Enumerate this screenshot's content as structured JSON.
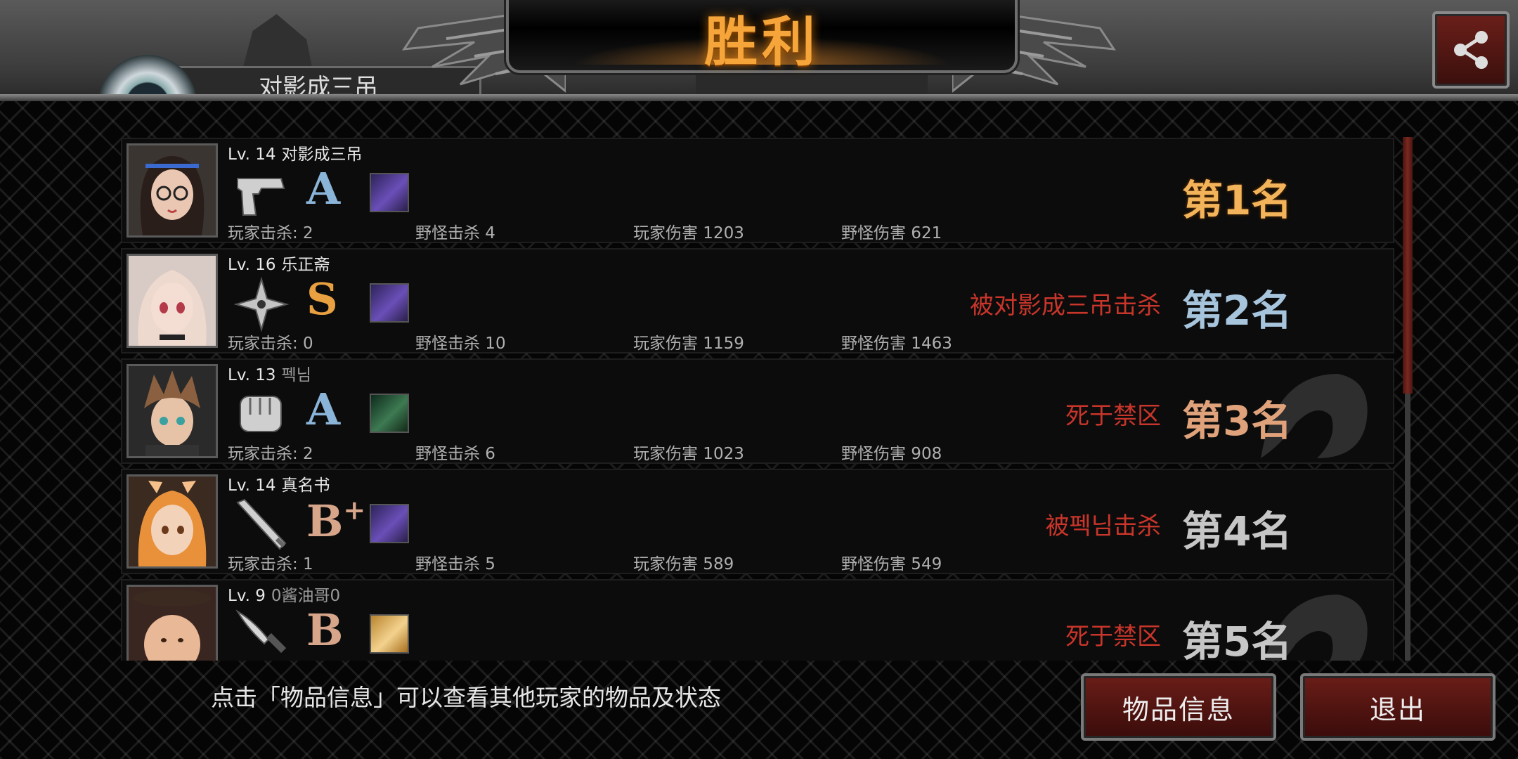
{
  "header": {
    "title": "胜利",
    "partial_name": "对影成三吊",
    "share_icon": "share-icon"
  },
  "players": [
    {
      "level": "Lv. 14",
      "name": "对影成三吊",
      "name_dim": false,
      "weapon": "pistol-icon",
      "grade": "A",
      "grade_plus": "",
      "item": "purple-armor-item-icon",
      "stats": {
        "player_kills": "玩家击杀: 2",
        "monster_kills": "野怪击杀 4",
        "player_damage": "玩家伤害 1203",
        "monster_damage": "野怪伤害 621"
      },
      "death": "",
      "place": "第1名"
    },
    {
      "level": "Lv. 16",
      "name": "乐正斋",
      "name_dim": false,
      "weapon": "shuriken-icon",
      "grade": "S",
      "grade_plus": "",
      "item": "purple-armor-item-icon",
      "stats": {
        "player_kills": "玩家击杀: 0",
        "monster_kills": "野怪击杀 10",
        "player_damage": "玩家伤害 1159",
        "monster_damage": "野怪伤害 1463"
      },
      "death": "被对影成三吊击杀",
      "place": "第2名"
    },
    {
      "level": "Lv. 13",
      "name": "펙님",
      "name_dim": true,
      "weapon": "fist-glove-icon",
      "grade": "A",
      "grade_plus": "",
      "item": "green-armor-item-icon",
      "stats": {
        "player_kills": "玩家击杀: 2",
        "monster_kills": "野怪击杀 6",
        "player_damage": "玩家伤害 1023",
        "monster_damage": "野怪伤害 908"
      },
      "death": "死于禁区",
      "place": "第3名"
    },
    {
      "level": "Lv. 14",
      "name": "真名书",
      "name_dim": false,
      "weapon": "bat-icon",
      "grade": "B",
      "grade_plus": "+",
      "item": "purple-armor-item-icon",
      "stats": {
        "player_kills": "玩家击杀: 1",
        "monster_kills": "野怪击杀 5",
        "player_damage": "玩家伤害 589",
        "monster_damage": "野怪伤害 549"
      },
      "death": "被펙님击杀",
      "place": "第4名"
    },
    {
      "level": "Lv. 9",
      "name": "0酱油哥0",
      "name_dim": true,
      "weapon": "knife-icon",
      "grade": "B",
      "grade_plus": "",
      "item": "gold-food-item-icon",
      "stats": {
        "player_kills": "",
        "monster_kills": "",
        "player_damage": "",
        "monster_damage": ""
      },
      "death": "死于禁区",
      "place": "第5名"
    }
  ],
  "footer": {
    "hint": "点击「物品信息」可以查看其他玩家的物品及状态",
    "info_button": "物品信息",
    "exit_button": "退出"
  },
  "colors": {
    "title": "#f6a53a",
    "death_text": "#c8352a",
    "button_red": "#6a1d18"
  }
}
